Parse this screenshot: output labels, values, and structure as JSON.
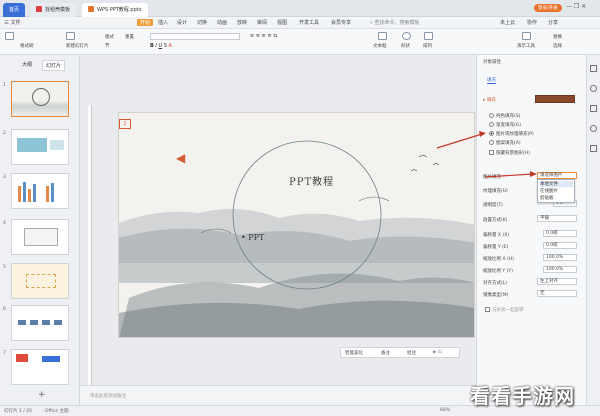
{
  "titlebar": {
    "tabs": [
      {
        "label": "首页"
      },
      {
        "label": "找稻壳模板"
      },
      {
        "label": "WPS PPT教程.pptx"
      }
    ],
    "right": "登录/开通"
  },
  "menubar": {
    "file": "三 文件",
    "items": [
      "开始",
      "插入",
      "设计",
      "切换",
      "动画",
      "放映",
      "审阅",
      "视图",
      "开发工具",
      "会员专享"
    ],
    "search": "查找命令，搜索模板",
    "right": [
      "未上云",
      "协作",
      "分享"
    ]
  },
  "ribbon": {
    "labels": [
      "格式刷",
      "新建幻灯片",
      "版式",
      "节",
      "重置",
      "从当前开始",
      "文本框",
      "形状",
      "排列",
      "演示工具",
      "替换",
      "选择"
    ]
  },
  "leftpane": {
    "tabs": [
      "大纲",
      "幻灯片"
    ],
    "numbers": [
      "1",
      "2",
      "3",
      "4",
      "5",
      "6",
      "7"
    ]
  },
  "slide": {
    "title": "PPT教程",
    "subtitle": "PPT"
  },
  "rightpane": {
    "header": "对象属性",
    "tab": "填充",
    "section": "▸ 填充",
    "options": [
      {
        "label": "纯色填充(S)",
        "on": false
      },
      {
        "label": "渐变填充(G)",
        "on": false
      },
      {
        "label": "图片或纹理填充(P)",
        "on": true
      },
      {
        "label": "图案填充(A)",
        "on": false
      }
    ],
    "hide_bg": "隐藏背景图形(H)",
    "rows": [
      {
        "label": "图片填充",
        "value": "请选择图片"
      },
      {
        "label": "纹理填充(U)",
        "value": ""
      },
      {
        "label": "透明度(T)",
        "value": "0%"
      },
      {
        "label": "放置方式(K)",
        "value": "平铺"
      },
      {
        "label": "偏移量 X (X)",
        "value": "0.0磅"
      },
      {
        "label": "偏移量 Y (E)",
        "value": "0.0磅"
      },
      {
        "label": "缩放比例 X (H)",
        "value": "100.0%"
      },
      {
        "label": "缩放比例 Y (Y)",
        "value": "100.0%"
      },
      {
        "label": "对齐方式(L)",
        "value": "左上对齐"
      },
      {
        "label": "镜像类型(M)",
        "value": "无"
      }
    ],
    "with_shape": "与形状一起旋转",
    "dropdown": [
      "本地文件",
      "在线图片",
      "剪贴板"
    ]
  },
  "floatbar": [
    "智能美化",
    "备注",
    "批注"
  ],
  "notes": {
    "placeholder": "单击此处添加备注"
  },
  "statusbar": {
    "slide": "幻灯片 1 / 20",
    "theme": "Office 主题",
    "zoom": "68%"
  },
  "watermark": "看看手游网",
  "colors": {
    "accent": "#d65a31",
    "fill_swatch": "#8b4a2b",
    "arrow": "#c0392b"
  }
}
